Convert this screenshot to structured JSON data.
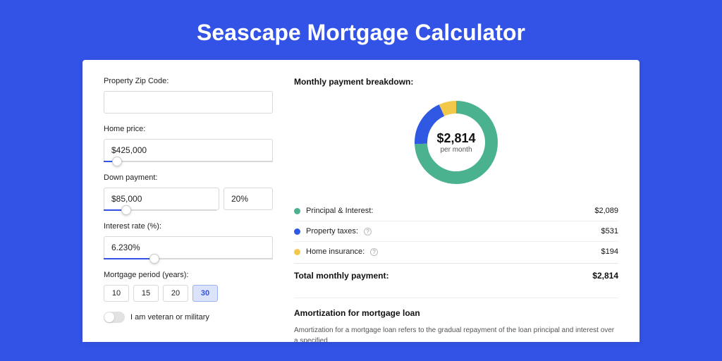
{
  "page": {
    "title": "Seascape Mortgage Calculator"
  },
  "form": {
    "zip_label": "Property Zip Code:",
    "zip_value": "",
    "home_price_label": "Home price:",
    "home_price_value": "$425,000",
    "home_price_slider_pct": 8,
    "down_payment_label": "Down payment:",
    "down_payment_value": "$85,000",
    "down_payment_pct": "20%",
    "down_payment_slider_pct": 20,
    "interest_label": "Interest rate (%):",
    "interest_value": "6.230%",
    "interest_slider_pct": 30,
    "period_label": "Mortgage period (years):",
    "period_options": [
      "10",
      "15",
      "20",
      "30"
    ],
    "period_selected": "30",
    "veteran_label": "I am veteran or military",
    "veteran_on": false
  },
  "breakdown": {
    "title": "Monthly payment breakdown:",
    "donut_amount": "$2,814",
    "donut_sub": "per month",
    "items": [
      {
        "label": "Principal & Interest:",
        "value": "$2,089",
        "color": "#4bb28f",
        "info": false
      },
      {
        "label": "Property taxes:",
        "value": "$531",
        "color": "#2f58e3",
        "info": true
      },
      {
        "label": "Home insurance:",
        "value": "$194",
        "color": "#f2c84b",
        "info": true
      }
    ],
    "total_label": "Total monthly payment:",
    "total_value": "$2,814"
  },
  "chart_data": {
    "type": "pie",
    "title": "Monthly payment breakdown",
    "series": [
      {
        "name": "Principal & Interest",
        "value": 2089,
        "color": "#4bb28f"
      },
      {
        "name": "Property taxes",
        "value": 531,
        "color": "#2f58e3"
      },
      {
        "name": "Home insurance",
        "value": 194,
        "color": "#f2c84b"
      }
    ],
    "total": 2814,
    "center_label": "$2,814 per month"
  },
  "amortization": {
    "title": "Amortization for mortgage loan",
    "text": "Amortization for a mortgage loan refers to the gradual repayment of the loan principal and interest over a specified"
  }
}
